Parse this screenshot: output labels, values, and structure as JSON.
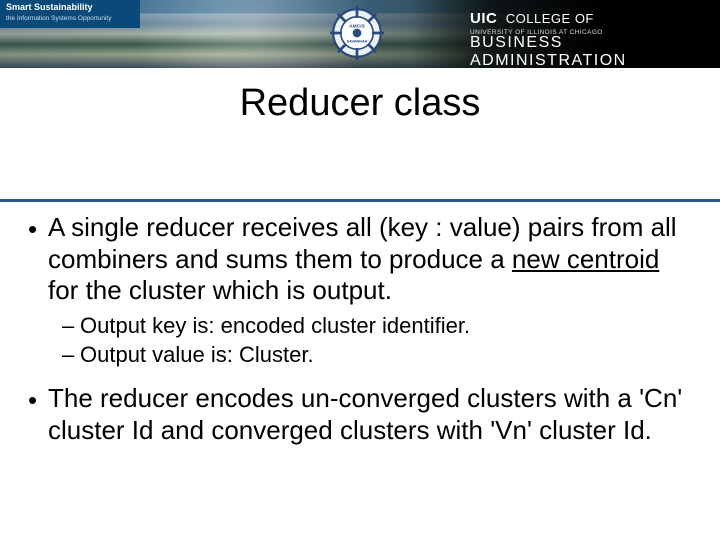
{
  "banner": {
    "left_title": "Smart Sustainability",
    "left_sub": "the Information Systems Opportunity",
    "wheel_top": "AMCIS",
    "wheel_bottom": "SAVANNAH",
    "uic": "UIC",
    "college": "COLLEGE OF",
    "univ": "UNIVERSITY OF ILLINOIS AT CHICAGO",
    "biz": "BUSINESS ADMINISTRATION"
  },
  "title": "Reducer class",
  "bullets": [
    {
      "text_parts": {
        "p1": "A single reducer receives all (key : value) pairs from all combiners and sums them to produce a ",
        "p2": "new centroid",
        "p3": " for the cluster which is output."
      },
      "subs": [
        "Output key is: encoded cluster identifier.",
        "Output value is: Cluster."
      ]
    },
    {
      "text": "The reducer encodes un-converged clusters with a 'Cn' cluster Id and converged clusters with 'Vn' cluster Id."
    }
  ]
}
